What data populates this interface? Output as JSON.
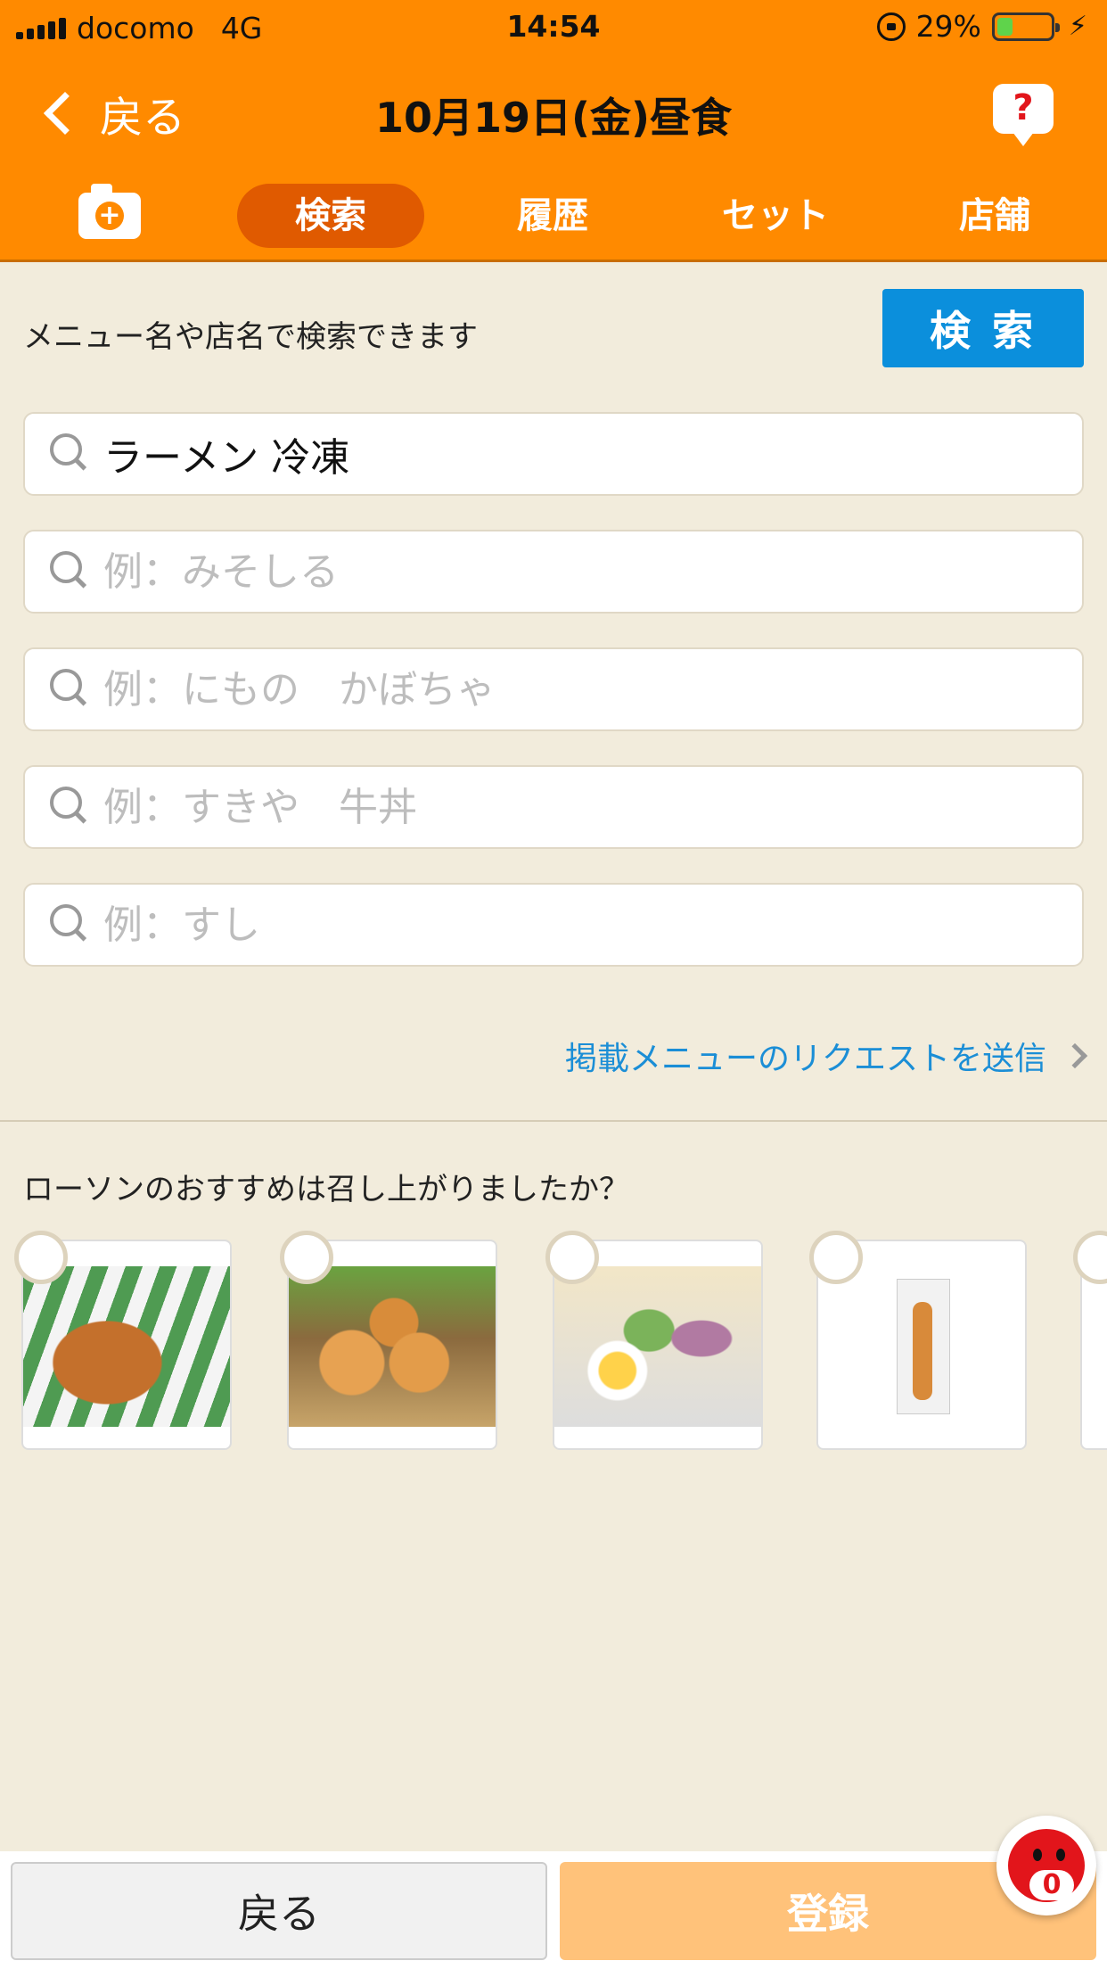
{
  "status_bar": {
    "carrier": "docomo",
    "network": "4G",
    "time": "14:54",
    "battery_percent": "29%",
    "battery_level": 0.29
  },
  "nav": {
    "back_label": "戻る",
    "title": "10月19日(金)昼食",
    "help_symbol": "?"
  },
  "tabs": [
    {
      "label": "検索",
      "active": true
    },
    {
      "label": "履歴",
      "active": false
    },
    {
      "label": "セット",
      "active": false
    },
    {
      "label": "店舗",
      "active": false
    }
  ],
  "search": {
    "hint": "メニュー名や店名で検索できます",
    "button_label": "検 索",
    "fields": [
      {
        "value": "ラーメン 冷凍",
        "placeholder": ""
      },
      {
        "value": "",
        "placeholder": "例：みそしる"
      },
      {
        "value": "",
        "placeholder": "例：にもの　かぼちゃ"
      },
      {
        "value": "",
        "placeholder": "例：すきや　牛丼"
      },
      {
        "value": "",
        "placeholder": "例：すし"
      }
    ]
  },
  "request_link": "掲載メニューのリクエストを送信",
  "recommend": {
    "title": "ローソンのおすすめは召し上がりましたか？"
  },
  "footer": {
    "back_label": "戻る",
    "register_label": "登録",
    "counter": "0"
  },
  "colors": {
    "header": "#ff8a00",
    "active_tab": "#e05a00",
    "search_button": "#0b8fdc",
    "background": "#f2ecdc",
    "register_button": "#ffc27a",
    "link": "#1b8ed6"
  }
}
